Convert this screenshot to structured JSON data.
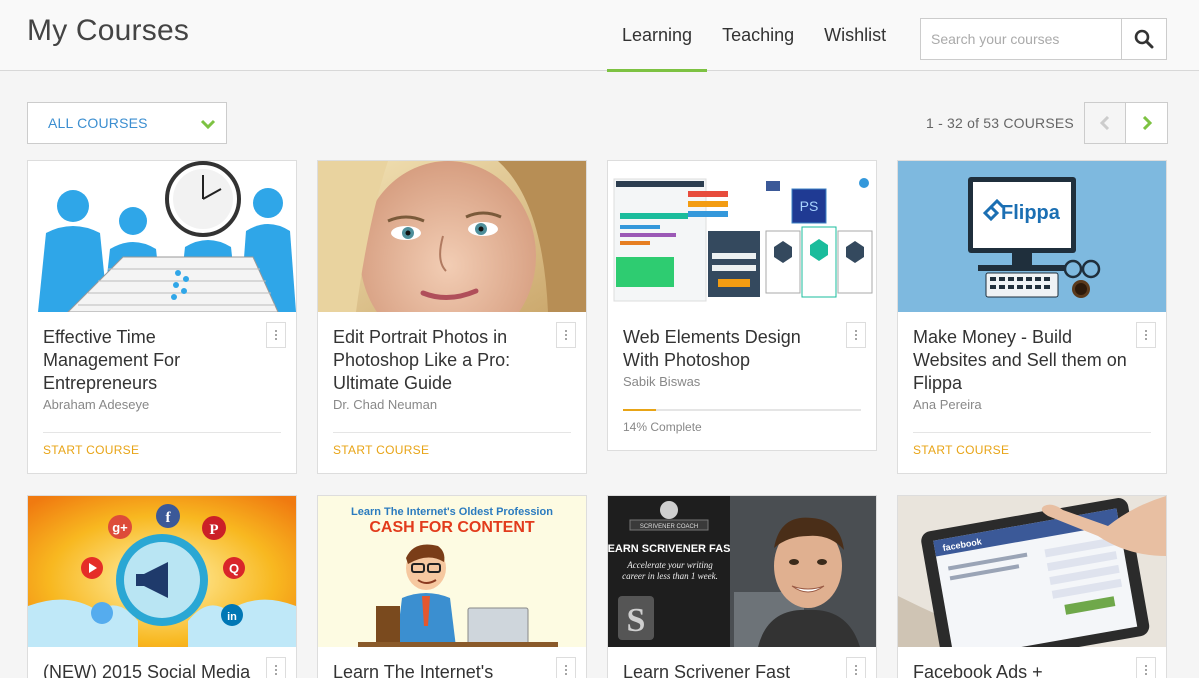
{
  "header": {
    "title": "My Courses",
    "tabs": [
      {
        "label": "Learning"
      },
      {
        "label": "Teaching"
      },
      {
        "label": "Wishlist"
      }
    ],
    "search_placeholder": "Search your courses"
  },
  "toolbar": {
    "filter_label": "ALL COURSES",
    "count_text": "1 - 32 of 53 COURSES"
  },
  "colors": {
    "accent_green": "#7dc242",
    "link_blue": "#3b8ed0",
    "cta_orange": "#e8a416"
  },
  "courses": [
    {
      "title": "Effective Time Management For Entrepreneurs",
      "author": "Abraham Adeseye",
      "action": "START COURSE"
    },
    {
      "title": "Edit Portrait Photos in Photoshop Like a Pro: Ultimate Guide",
      "author": "Dr. Chad Neuman",
      "action": "START COURSE"
    },
    {
      "title": "Web Elements Design With Photoshop",
      "author": "Sabik Biswas",
      "progress_label": "14% Complete",
      "progress": 0.14
    },
    {
      "title": "Make Money - Build Websites and Sell them on Flippa",
      "author": "Ana Pereira",
      "action": "START COURSE"
    },
    {
      "title": "(NEW) 2015 Social Media"
    },
    {
      "title": "Learn The Internet's"
    },
    {
      "title": "Learn Scrivener Fast"
    },
    {
      "title": "Facebook Ads +"
    }
  ],
  "thumbnails": {
    "flippa_logo": "Flippa",
    "ps_badge": "PS",
    "cash_title_top": "Learn The Internet's Oldest Profession",
    "cash_title_main": "CASH FOR CONTENT",
    "scrivener_main": "LEARN SCRIVENER FAST",
    "scrivener_sub": "Accelerate your writing career in less than 1 week.",
    "scrivener_badge": "SCRIVENER COACH",
    "facebook_word": "facebook"
  }
}
